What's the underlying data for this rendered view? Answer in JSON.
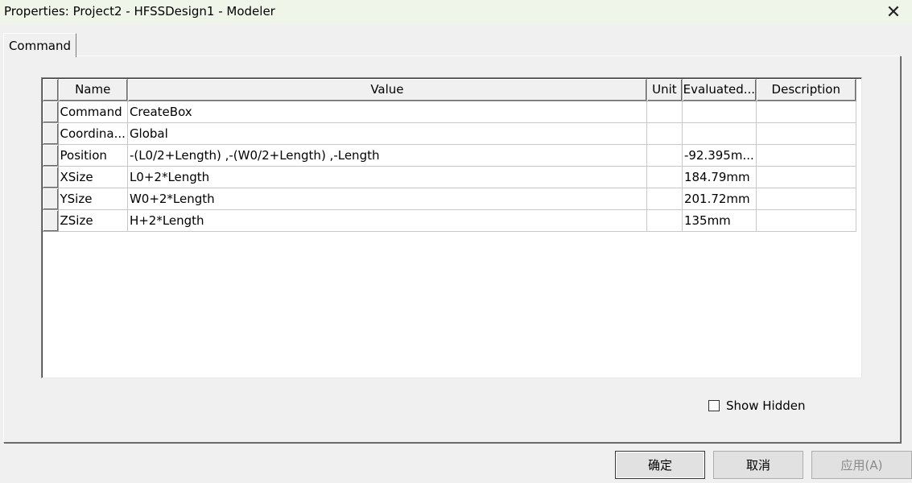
{
  "window": {
    "title": "Properties: Project2 - HFSSDesign1 - Modeler",
    "close_glyph": "✕"
  },
  "tabs": [
    {
      "label": "Command"
    }
  ],
  "grid": {
    "columns": [
      "Name",
      "Value",
      "Unit",
      "Evaluated...",
      "Description"
    ],
    "rows": [
      {
        "name": "Command",
        "value": "CreateBox",
        "unit": "",
        "evaluated": "",
        "description": ""
      },
      {
        "name": "Coordina...",
        "value": "Global",
        "unit": "",
        "evaluated": "",
        "description": ""
      },
      {
        "name": "Position",
        "value": "-(L0/2+Length) ,-(W0/2+Length) ,-Length",
        "unit": "",
        "evaluated": "-92.395m...",
        "description": ""
      },
      {
        "name": "XSize",
        "value": "L0+2*Length",
        "unit": "",
        "evaluated": "184.79mm",
        "description": ""
      },
      {
        "name": "YSize",
        "value": "W0+2*Length",
        "unit": "",
        "evaluated": "201.72mm",
        "description": ""
      },
      {
        "name": "ZSize",
        "value": "H+2*Length",
        "unit": "",
        "evaluated": "135mm",
        "description": ""
      }
    ]
  },
  "show_hidden": {
    "label": "Show Hidden",
    "checked": false
  },
  "buttons": {
    "ok": "确定",
    "cancel": "取消",
    "apply": "应用(A)"
  }
}
